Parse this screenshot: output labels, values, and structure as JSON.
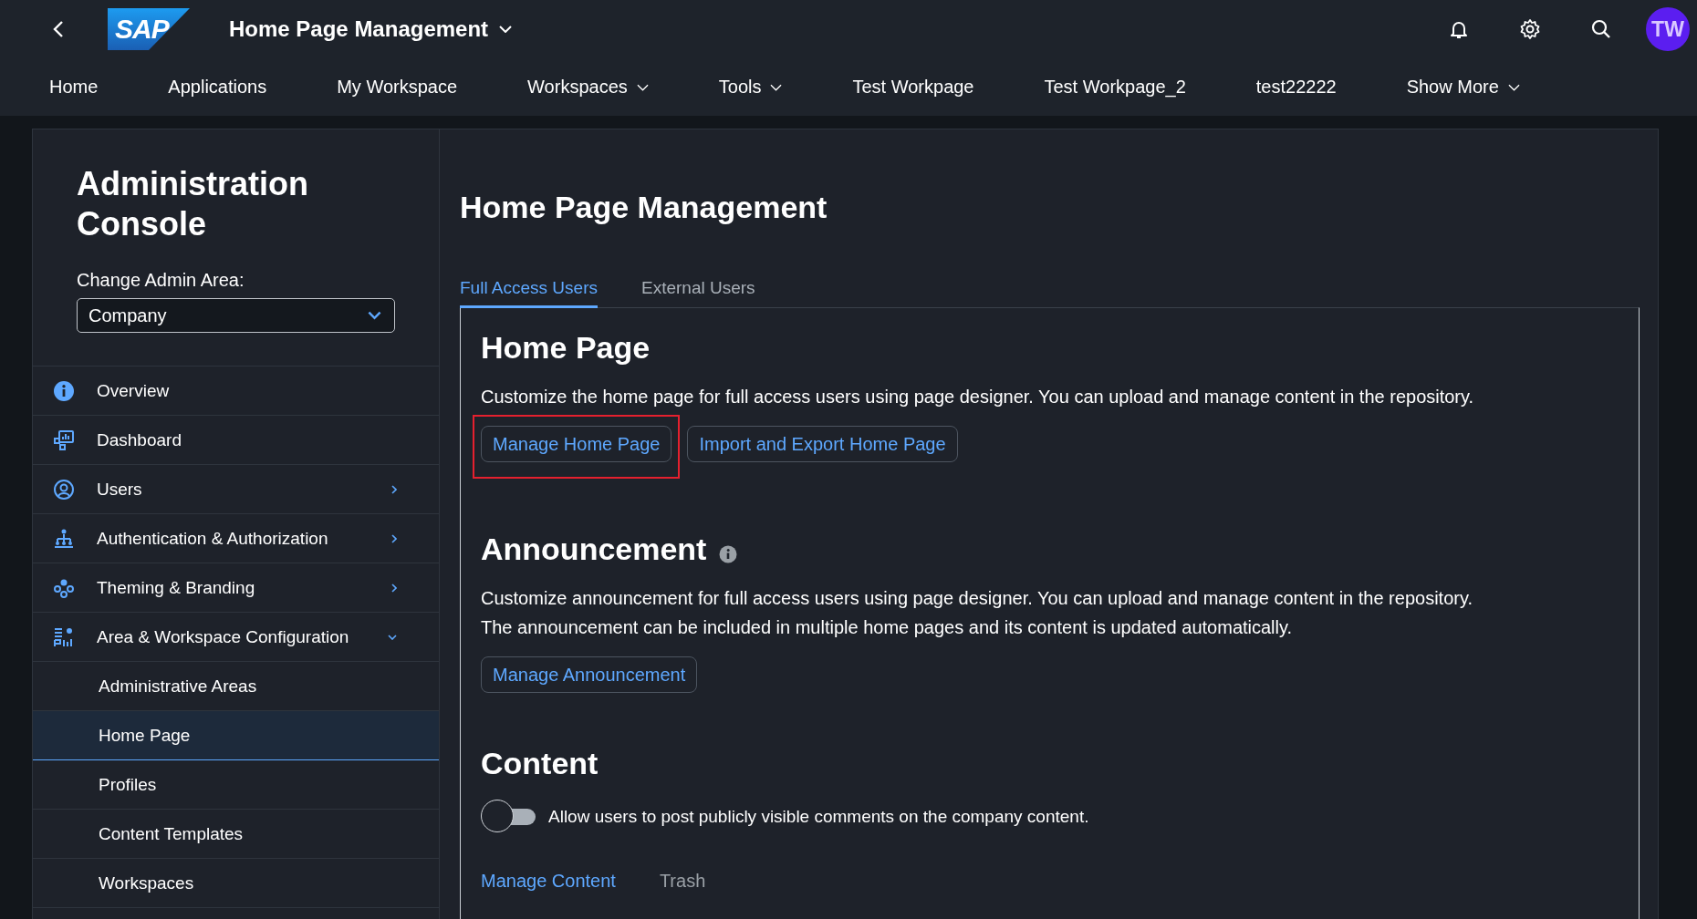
{
  "header": {
    "title": "Home Page Management",
    "logo": "SAP",
    "avatar": "TW"
  },
  "nav": [
    {
      "label": "Home",
      "has_menu": false
    },
    {
      "label": "Applications",
      "has_menu": false
    },
    {
      "label": "My Workspace",
      "has_menu": false
    },
    {
      "label": "Workspaces",
      "has_menu": true
    },
    {
      "label": "Tools",
      "has_menu": true
    },
    {
      "label": "Test Workpage",
      "has_menu": false
    },
    {
      "label": "Test Workpage_2",
      "has_menu": false
    },
    {
      "label": "test22222",
      "has_menu": false
    },
    {
      "label": "Show More",
      "has_menu": true
    }
  ],
  "sidebar": {
    "title": "Administration Console",
    "area_label": "Change Admin Area:",
    "area_value": "Company",
    "items": [
      {
        "label": "Overview",
        "kind": "info"
      },
      {
        "label": "Dashboard",
        "kind": "dashboard"
      },
      {
        "label": "Users",
        "kind": "user",
        "expanded": false
      },
      {
        "label": "Authentication & Authorization",
        "kind": "hierarchy",
        "expanded": false
      },
      {
        "label": "Theming & Branding",
        "kind": "circles",
        "expanded": false
      },
      {
        "label": "Area & Workspace Configuration",
        "kind": "config",
        "expanded": true,
        "children": [
          {
            "label": "Administrative Areas",
            "selected": false
          },
          {
            "label": "Home Page",
            "selected": true
          },
          {
            "label": "Profiles",
            "selected": false
          },
          {
            "label": "Content Templates",
            "selected": false
          },
          {
            "label": "Workspaces",
            "selected": false
          }
        ]
      }
    ]
  },
  "main": {
    "title": "Home Page Management",
    "tabs": [
      {
        "label": "Full Access Users",
        "selected": true
      },
      {
        "label": "External Users",
        "selected": false
      }
    ],
    "sections": [
      {
        "kind": "buttons",
        "title": "Home Page",
        "info": false,
        "text": [
          "Customize the home page for full access users using page designer. You can upload and manage content in the repository."
        ],
        "buttons": [
          {
            "label": "Manage Home Page",
            "highlighted": true
          },
          {
            "label": "Import and Export Home Page",
            "highlighted": false
          }
        ]
      },
      {
        "kind": "buttons",
        "title": "Announcement",
        "info": true,
        "text": [
          "Customize announcement for full access users using page designer. You can upload and manage content in the repository.",
          "The announcement can be included in multiple home pages and its content is updated automatically."
        ],
        "buttons": [
          {
            "label": "Manage Announcement",
            "highlighted": false
          }
        ]
      },
      {
        "kind": "toggle",
        "title": "Content",
        "info": false,
        "toggle": {
          "on": false,
          "label": "Allow users to post publicly visible comments on the company content."
        },
        "tabs": [
          {
            "label": "Manage Content",
            "selected": true
          },
          {
            "label": "Trash",
            "selected": false
          }
        ]
      }
    ]
  }
}
